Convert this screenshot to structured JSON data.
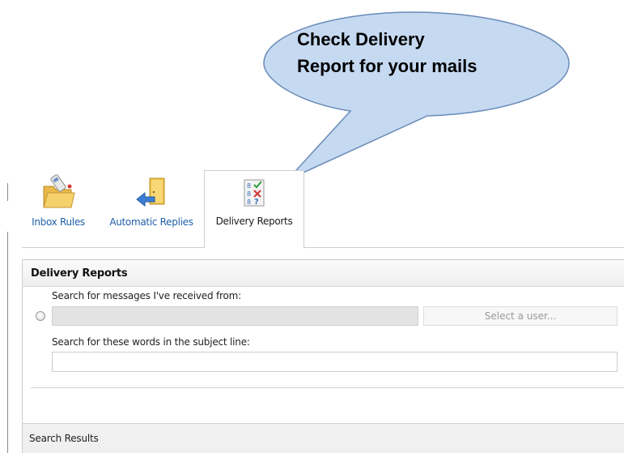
{
  "callout": {
    "line1": "Check Delivery",
    "line2": "Report for your mails",
    "fill_color": "#c5d9f1",
    "border_color": "#6a8cb8"
  },
  "tabs": [
    {
      "label": "Inbox Rules",
      "icon": "folder-rules-icon",
      "active": false
    },
    {
      "label": "Automatic Replies",
      "icon": "door-arrow-icon",
      "active": false
    },
    {
      "label": "Delivery Reports",
      "icon": "delivery-report-icon",
      "active": true
    }
  ],
  "panel": {
    "title": "Delivery Reports",
    "from_label": "Search for messages I've received from:",
    "from_value": "",
    "select_user_label": "Select a user...",
    "subject_label": "Search for these words in the subject line:",
    "subject_value": ""
  },
  "results": {
    "title": "Search Results"
  },
  "colors": {
    "link": "#1f5fa8",
    "header_bg": "#eeeeee",
    "input_disabled_bg": "#e3e3e3"
  }
}
